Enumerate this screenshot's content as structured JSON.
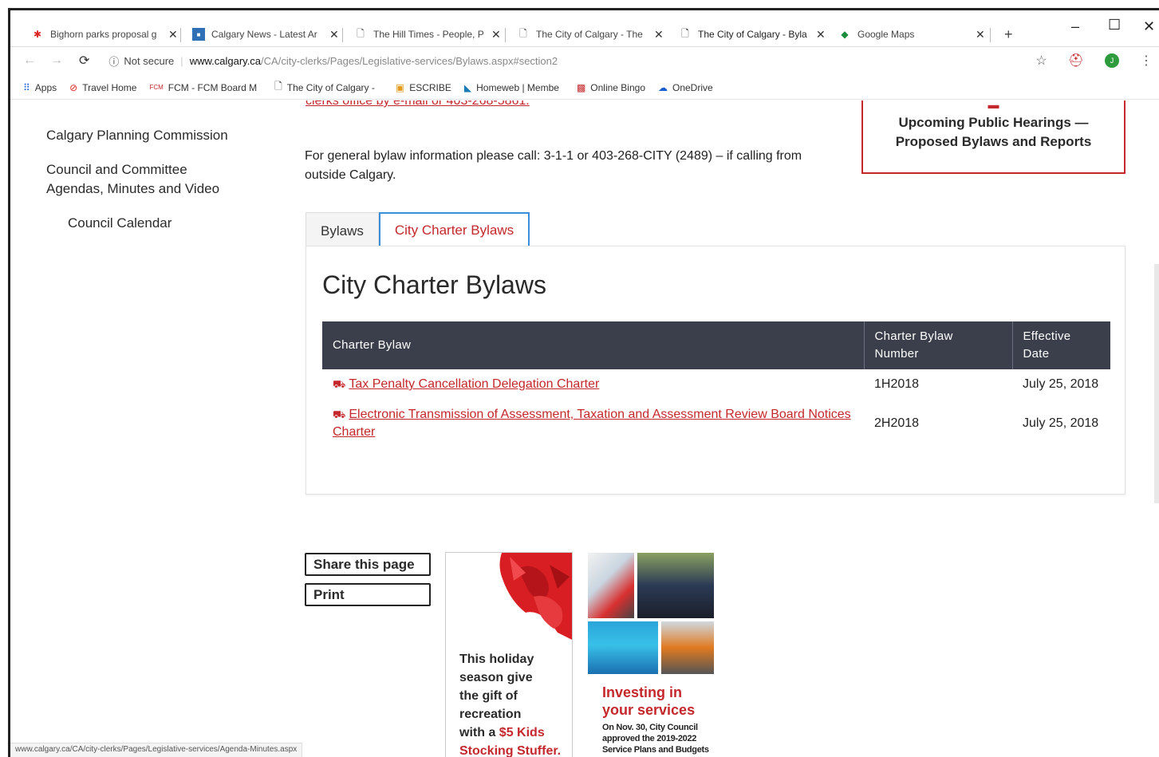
{
  "browser": {
    "tabs": [
      {
        "title": "Bighorn parks proposal g",
        "favicon": "maple-leaf-icon",
        "active": false
      },
      {
        "title": "Calgary News - Latest Ar",
        "favicon": "news-icon",
        "active": false
      },
      {
        "title": "The Hill Times - People, P",
        "favicon": "page-icon",
        "active": false
      },
      {
        "title": "The City of Calgary - The",
        "favicon": "page-icon",
        "active": false
      },
      {
        "title": "The City of Calgary - Byla",
        "favicon": "page-icon",
        "active": true
      },
      {
        "title": "Google Maps",
        "favicon": "maps-icon",
        "active": false
      }
    ],
    "new_tab": "+",
    "not_secure": "Not secure",
    "url_host": "www.calgary.ca",
    "url_path": "/CA/city-clerks/Pages/Legislative-services/Bylaws.aspx#section2",
    "avatar_letter": "J",
    "bookmarks": [
      {
        "label": "Apps",
        "icon": "apps-grid-icon"
      },
      {
        "label": "Travel Home",
        "icon": "travel-icon"
      },
      {
        "label": "FCM - FCM Board M",
        "icon": "fcm-icon"
      },
      {
        "label": "The City of Calgary -",
        "icon": "page-icon"
      },
      {
        "label": "ESCRIBE",
        "icon": "escribe-icon"
      },
      {
        "label": "Homeweb | Membe",
        "icon": "homeweb-icon"
      },
      {
        "label": "Online Bingo",
        "icon": "bingo-icon"
      },
      {
        "label": "OneDrive",
        "icon": "cloud-icon"
      }
    ]
  },
  "page": {
    "clipped_link": "clerks office by e-mail or 403-268-5861.",
    "left_nav": {
      "planning_commission": "Calgary Planning Commission",
      "council_agendas_line1": "Council and Committee",
      "council_agendas_line2": "Agendas, Minutes and Video",
      "council_calendar": "Council Calendar"
    },
    "general_info": "For general bylaw information please call: 3-1-1 or 403-268-CITY (2489) – if calling from outside Calgary.",
    "hearings_box": {
      "line1": "Upcoming Public Hearings —",
      "line2": "Proposed Bylaws and Reports"
    },
    "tabs": {
      "bylaws": "Bylaws",
      "charter": "City Charter Bylaws"
    },
    "panel_title": "City Charter Bylaws",
    "table": {
      "headers": {
        "bylaw": "Charter Bylaw",
        "number_line1": "Charter Bylaw",
        "number_line2": "Number",
        "date_line1": "Effective",
        "date_line2": "Date"
      },
      "rows": [
        {
          "title": "Tax Penalty Cancellation Delegation Charter",
          "number": "1H2018",
          "date": "July 25, 2018"
        },
        {
          "title": "Electronic Transmission of Assessment, Taxation and Assessment Review Board Notices Charter",
          "number": "2H2018",
          "date": "July 25, 2018"
        }
      ]
    },
    "share": "Share this page",
    "print": "Print",
    "promo1": {
      "line1": "This holiday",
      "line2": "season give",
      "line3": "the gift of",
      "line4": "recreation",
      "line5": "with a",
      "line5_red": "$5 Kids",
      "line6_red": "Stocking Stuffer."
    },
    "promo2": {
      "title_line1": "Investing in",
      "title_line2": "your services",
      "sub_line1": "On Nov. 30, City Council",
      "sub_line2": "approved the 2019-2022",
      "sub_line3": "Service Plans and Budgets"
    }
  },
  "status_bar": "www.calgary.ca/CA/city-clerks/Pages/Legislative-services/Agenda-Minutes.aspx",
  "colors": {
    "brand_red": "#c4282c",
    "table_header": "#3a3f4b",
    "active_tab_border": "#3b8fd9"
  }
}
